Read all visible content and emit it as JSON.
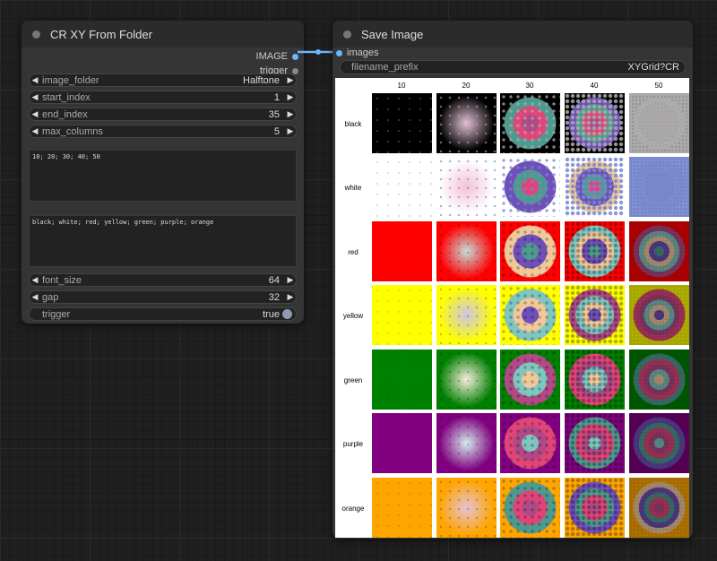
{
  "left_node": {
    "title": "CR XY From Folder",
    "outputs": [
      {
        "label": "IMAGE",
        "color": "#6bb6ff"
      },
      {
        "label": "trigger",
        "color": "#888888"
      }
    ],
    "widgets": [
      {
        "label": "image_folder",
        "value": "Halftone"
      },
      {
        "label": "start_index",
        "value": "1"
      },
      {
        "label": "end_index",
        "value": "35"
      },
      {
        "label": "max_columns",
        "value": "5"
      }
    ],
    "x_text": "10; 20; 30; 40; 50",
    "y_text": "black; white; red; yellow; green; purple; orange",
    "widgets2": [
      {
        "label": "font_size",
        "value": "64"
      },
      {
        "label": "gap",
        "value": "32"
      }
    ],
    "trigger": {
      "label": "trigger",
      "value": "true"
    }
  },
  "right_node": {
    "title": "Save Image",
    "input_label": "images",
    "filename_label": "filename_prefix",
    "filename_value": "XYGrid?CR",
    "columns": [
      "10",
      "20",
      "30",
      "40",
      "50"
    ],
    "rows": [
      "black",
      "white",
      "red",
      "yellow",
      "green",
      "purple",
      "orange"
    ],
    "row_colors": [
      "#000000",
      "#ffffff",
      "#ff0000",
      "#ffff00",
      "#008000",
      "#800080",
      "#ffa500"
    ]
  },
  "colors": {
    "link": "#6bb6ff"
  }
}
